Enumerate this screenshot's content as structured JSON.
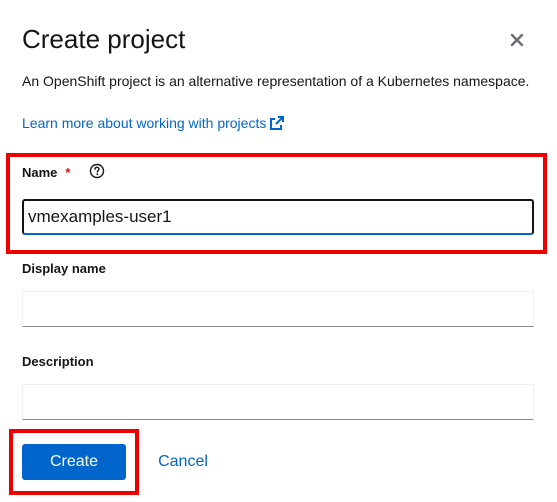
{
  "modal": {
    "title": "Create project",
    "description": "An OpenShift project is an alternative representation of a Kubernetes namespace.",
    "learn_more_link": "Learn more about working with projects"
  },
  "form": {
    "name": {
      "label": "Name",
      "required_marker": "*",
      "value": "vmexamples-user1"
    },
    "display_name": {
      "label": "Display name",
      "value": ""
    },
    "description": {
      "label": "Description",
      "value": ""
    }
  },
  "actions": {
    "create_label": "Create",
    "cancel_label": "Cancel"
  },
  "colors": {
    "primary": "#0066cc",
    "required": "#c9190b",
    "highlight": "#ee0000"
  },
  "icons": {
    "close": "close-icon",
    "help": "help-icon",
    "external_link": "external-link-icon"
  }
}
